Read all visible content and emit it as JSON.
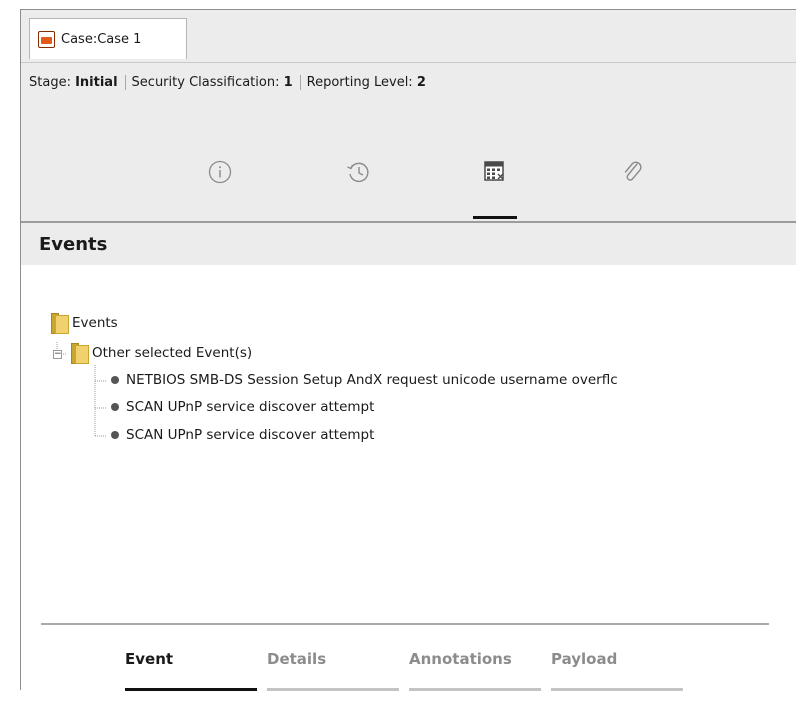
{
  "window": {
    "tab_label": "Case:Case 1"
  },
  "info_bar": {
    "stage_label": "Stage:",
    "stage_value": "Initial",
    "security_label": "Security Classification:",
    "security_value": "1",
    "reporting_label": "Reporting Level:",
    "reporting_value": "2"
  },
  "icon_tabs": [
    {
      "name": "info-icon",
      "selected": false
    },
    {
      "name": "history-icon",
      "selected": false
    },
    {
      "name": "events-calculator-icon",
      "selected": true
    },
    {
      "name": "paperclip-icon",
      "selected": false
    }
  ],
  "section": {
    "title": "Events"
  },
  "tree": {
    "root_label": "Events",
    "group_label": "Other selected Event(s)",
    "group_expander": "−",
    "items": [
      "NETBIOS SMB-DS Session Setup AndX request unicode username overflc",
      "SCAN UPnP service discover attempt",
      "SCAN UPnP service discover attempt"
    ]
  },
  "bottom_tabs": [
    {
      "label": "Event",
      "selected": true
    },
    {
      "label": "Details",
      "selected": false
    },
    {
      "label": "Annotations",
      "selected": false
    },
    {
      "label": "Payload",
      "selected": false
    }
  ],
  "colors": {
    "panel_bg": "#ececec",
    "content_bg": "#ffffff",
    "selected_tab_text": "#1a1a1a",
    "unselected_tab_text": "#8c8c8c",
    "unselected_tab_line": "#c4c4c4",
    "selected_tab_line": "#111111"
  }
}
